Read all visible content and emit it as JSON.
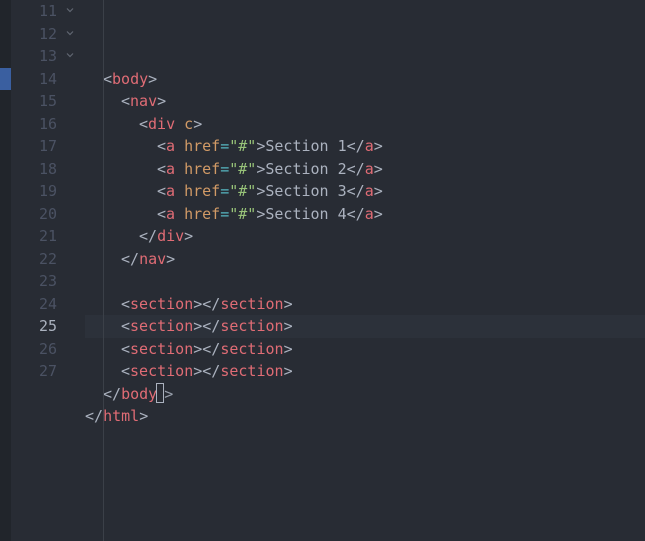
{
  "editor": {
    "first_line": 11,
    "lines_shown": 17,
    "current_line": 25,
    "blue_marker_line": 14,
    "fold_lines": [
      11,
      12,
      13
    ],
    "tokens": {
      "body": "body",
      "nav": "nav",
      "div": "div",
      "div_attr": "c",
      "a": "a",
      "href": "href",
      "hash": "\"#\"",
      "section": "section",
      "html": "html"
    },
    "anchor_text": [
      "Section 1",
      "Section 2",
      "Section 3",
      "Section 4"
    ]
  }
}
